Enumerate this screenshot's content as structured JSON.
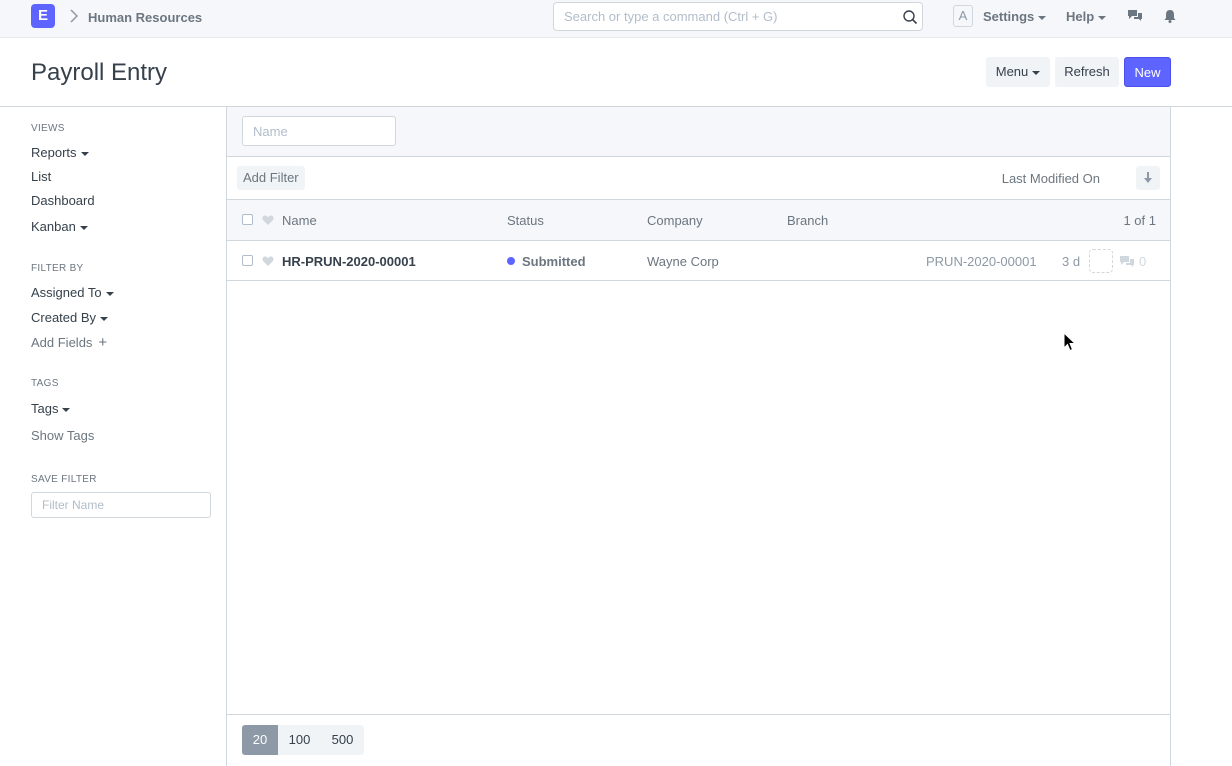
{
  "navbar": {
    "logo_letter": "E",
    "breadcrumb": "Human Resources",
    "search_placeholder": "Search or type a command (Ctrl + G)",
    "avatar_letter": "A",
    "settings_label": "Settings",
    "help_label": "Help"
  },
  "page": {
    "title": "Payroll Entry",
    "menu_label": "Menu",
    "refresh_label": "Refresh",
    "new_label": "New"
  },
  "sidebar": {
    "views_label": "VIEWS",
    "reports": "Reports",
    "list": "List",
    "dashboard": "Dashboard",
    "kanban": "Kanban",
    "filter_by_label": "FILTER BY",
    "assigned_to": "Assigned To",
    "created_by": "Created By",
    "add_fields": "Add Fields",
    "tags_label": "TAGS",
    "tags": "Tags",
    "show_tags": "Show Tags",
    "save_filter_label": "SAVE FILTER",
    "filter_name_placeholder": "Filter Name"
  },
  "list": {
    "name_filter_placeholder": "Name",
    "add_filter_label": "Add Filter",
    "sort_label": "Last Modified On",
    "columns": {
      "name": "Name",
      "status": "Status",
      "company": "Company",
      "branch": "Branch",
      "count": "1 of 1"
    },
    "rows": [
      {
        "name": "HR-PRUN-2020-00001",
        "status": "Submitted",
        "status_color": "#5e64ff",
        "company": "Wayne Corp",
        "branch": "",
        "id": "PRUN-2020-00001",
        "modified": "3 d",
        "comments": "0"
      }
    ],
    "page_sizes": [
      "20",
      "100",
      "500"
    ],
    "active_page_size": "20"
  },
  "colors": {
    "primary": "#5e64ff",
    "navbar_bg": "#f5f7fa",
    "text": "#36414c",
    "muted": "#6c7680"
  }
}
